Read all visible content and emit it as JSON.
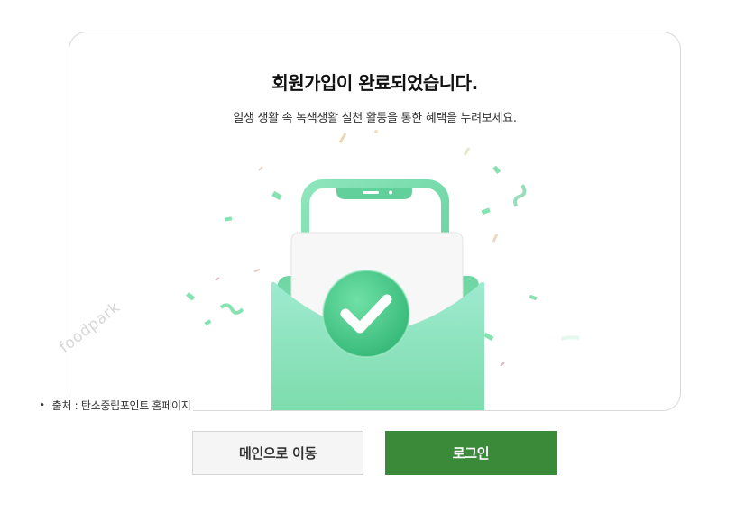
{
  "dialog": {
    "title": "회원가입이 완료되었습니다.",
    "subtitle": "일생 생활 속 녹색생활 실천 활동을 통한 혜택을 누려보세요."
  },
  "illustration": {
    "icon": "envelope-phone-checkmark-icon"
  },
  "source_note": {
    "bullet": "•",
    "text": "출처 : 탄소중립포인트 홈페이지"
  },
  "watermark": {
    "text": "foodpark"
  },
  "buttons": {
    "main_label": "메인으로 이동",
    "login_label": "로그인"
  },
  "colors": {
    "accent": "#3a8a39",
    "mint": "#7ddcac",
    "mint_dark": "#4bc98b",
    "confetti": "#86e3b1"
  }
}
